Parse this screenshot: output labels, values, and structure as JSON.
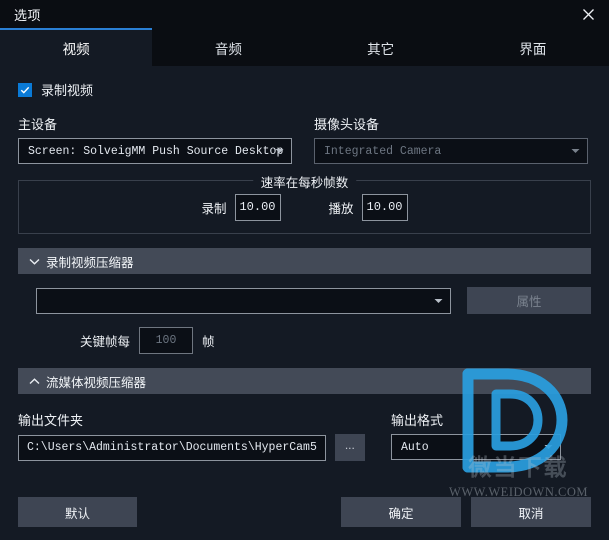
{
  "window": {
    "title": "选项",
    "close_icon": "close-icon"
  },
  "tabs": [
    {
      "label": "视频",
      "active": true
    },
    {
      "label": "音频",
      "active": false
    },
    {
      "label": "其它",
      "active": false
    },
    {
      "label": "界面",
      "active": false
    }
  ],
  "video": {
    "record_checkbox": {
      "label": "录制视频",
      "checked": true
    },
    "main_device": {
      "label": "主设备",
      "value": "Screen: SolveigMM Push Source Desktop Fi"
    },
    "camera_device": {
      "label": "摄像头设备",
      "value": "Integrated Camera",
      "disabled": true
    },
    "fps_group": {
      "legend": "速率在每秒帧数",
      "record_label": "录制",
      "record_value": "10.00",
      "playback_label": "播放",
      "playback_value": "10.00"
    },
    "record_compressor": {
      "header": "录制视频压缩器",
      "expanded": true,
      "codec_value": "",
      "properties_button": "属性",
      "keyframe_prefix": "关键帧每",
      "keyframe_value": "100",
      "keyframe_suffix": "帧"
    },
    "stream_compressor": {
      "header": "流媒体视频压缩器",
      "expanded": false
    },
    "output_folder": {
      "label": "输出文件夹",
      "value": "C:\\Users\\Administrator\\Documents\\HyperCam5",
      "browse_button": "..."
    },
    "output_format": {
      "label": "输出格式",
      "value": "Auto"
    }
  },
  "footer": {
    "default_button": "默认",
    "ok_button": "确定",
    "cancel_button": "取消"
  },
  "watermark": {
    "text": "微当下载",
    "url": "WWW.WEIDOWN.COM"
  },
  "colors": {
    "accent": "#2a7fd4",
    "checkbox": "#0a7ad6",
    "titlebar_bg": "#0a0d12",
    "content_bg": "#141a24",
    "section_header_bg": "#434a57",
    "button_bg": "#3e4553"
  }
}
